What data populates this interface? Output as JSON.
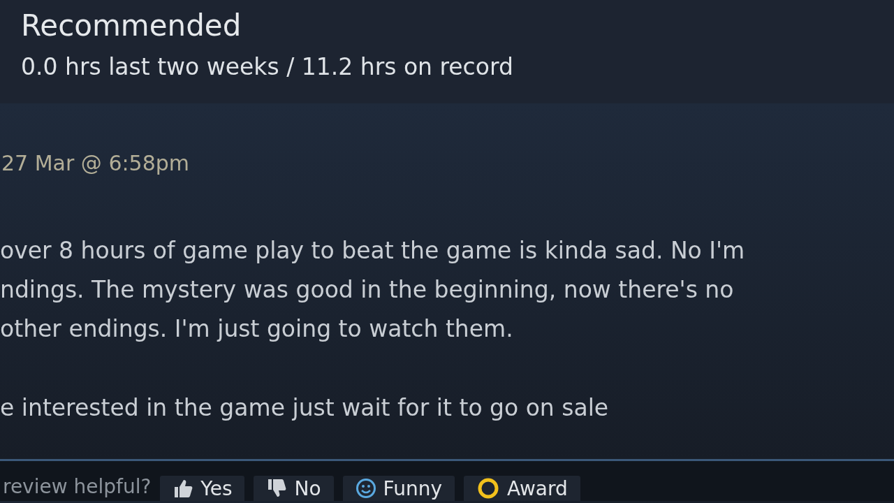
{
  "review": {
    "verdict": "Recommended",
    "hours": "0.0 hrs last two weeks / 11.2 hrs on record",
    "posted": "27 Mar @ 6:58pm",
    "paragraphs": [
      [
        "over 8 hours of game play to beat the game is kinda sad. No I'm",
        "ndings. The mystery was good in the beginning, now there's no",
        "other endings. I'm just going to watch them."
      ],
      [
        "e interested in the game just wait for it to go on sale"
      ]
    ]
  },
  "feedback": {
    "prompt": "review helpful?",
    "buttons": [
      {
        "kind": "yes",
        "label": "Yes"
      },
      {
        "kind": "no",
        "label": "No"
      },
      {
        "kind": "funny",
        "label": "Funny"
      },
      {
        "kind": "award",
        "label": "Award"
      }
    ]
  }
}
